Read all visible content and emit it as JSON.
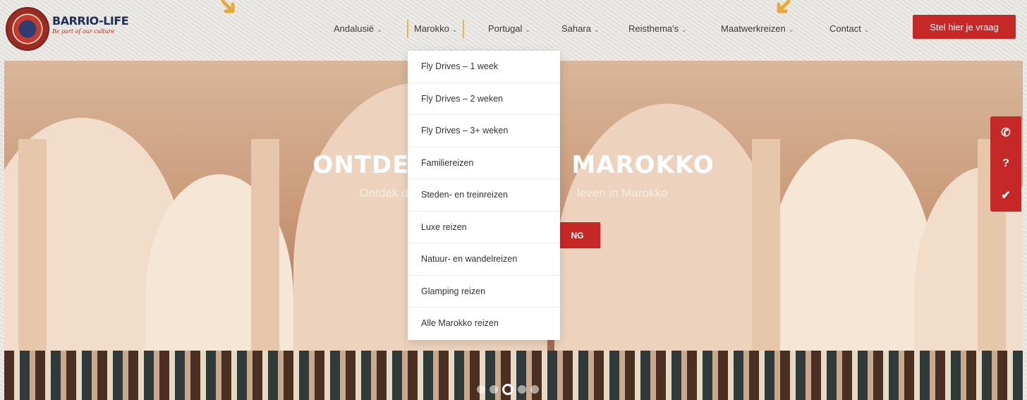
{
  "brand": {
    "name": "BARRIO-LIFE",
    "tagline": "Be part of our culture"
  },
  "nav": {
    "items": [
      {
        "label": "Andalusië",
        "chevron": "⌄"
      },
      {
        "label": "Marokko",
        "chevron": "⌄"
      },
      {
        "label": "Portugal",
        "chevron": "⌄"
      },
      {
        "label": "Sahara",
        "chevron": "⌄"
      },
      {
        "label": "Reisthema's",
        "chevron": "⌄"
      },
      {
        "label": "Maatwerkreizen",
        "chevron": "⌄"
      },
      {
        "label": "Contact",
        "chevron": "⌄"
      }
    ],
    "cta_label": "Stel hier je vraag"
  },
  "dropdown": {
    "items": [
      "Fly Drives – 1 week",
      "Fly Drives – 2 weken",
      "Fly Drives – 3+ weken",
      "Familiereizen",
      "Steden- en treinreizen",
      "Luxe reizen",
      "Natuur- en wandelreizen",
      "Glamping reizen",
      "Alle Marokko reizen"
    ]
  },
  "hero": {
    "title_left": "ONTDE",
    "title_right": "MAROKKO",
    "subtitle_left": "Ontdek de",
    "subtitle_right": "leven in Marokko",
    "button_label": "NG"
  },
  "side_buttons": {
    "phone": "✆",
    "question": "?",
    "check": "✔"
  },
  "colors": {
    "accent_red": "#c62828",
    "active_border": "#e8b25a",
    "arrow_yellow": "#e8a83c"
  }
}
